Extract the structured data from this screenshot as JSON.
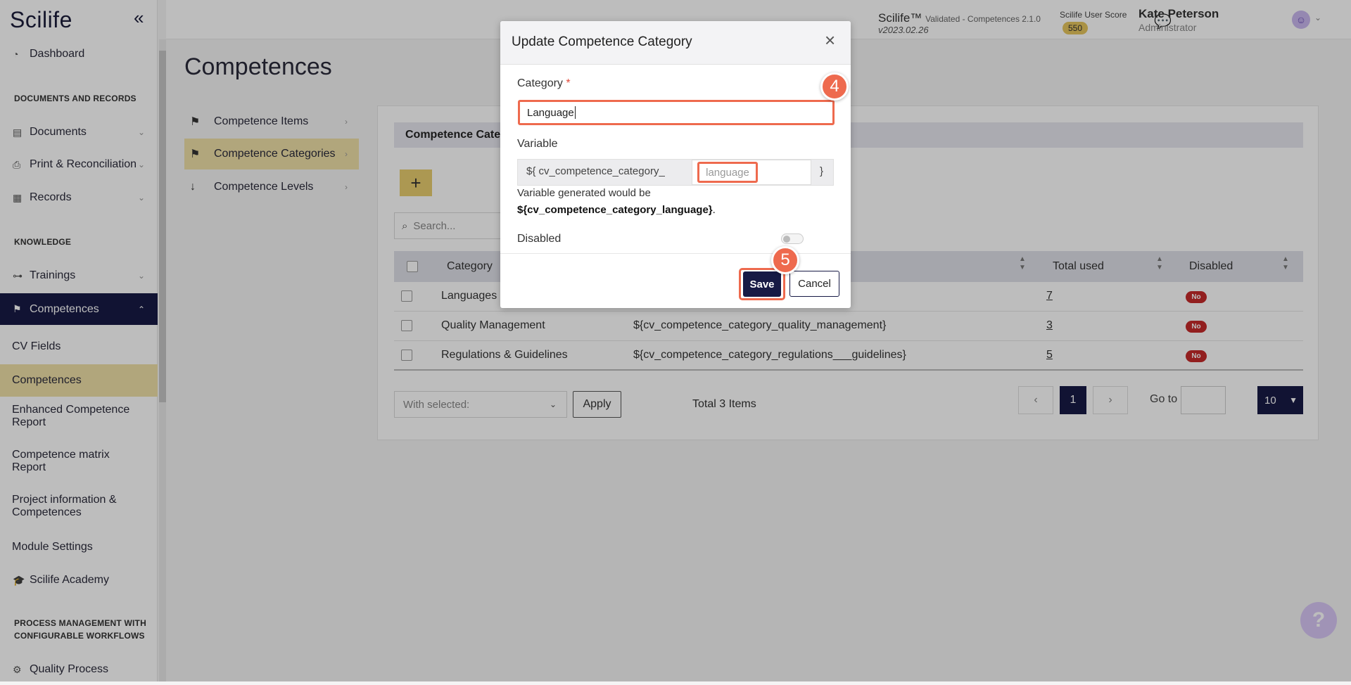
{
  "app": {
    "logo": "Scilife",
    "collapse_icon": "double-chevron-left-icon"
  },
  "topbar": {
    "brand": "Scilife™",
    "brand_sub": "Validated - Competences 2.1.0",
    "version": "v2023.02.26",
    "score_label": "Scilife User Score",
    "score_value": "550",
    "user_name": "Kate Peterson",
    "user_role": "Administrator"
  },
  "sidebar": {
    "dashboard": "Dashboard",
    "section_docs": "DOCUMENTS AND RECORDS",
    "documents": "Documents",
    "print": "Print & Reconciliation",
    "records": "Records",
    "section_knowledge": "KNOWLEDGE",
    "trainings": "Trainings",
    "competences": "Competences",
    "cv_fields": "CV Fields",
    "competences_sub": "Competences",
    "enhanced_report_1": "Enhanced Competence",
    "enhanced_report_2": "Report",
    "matrix_report_1": "Competence matrix",
    "matrix_report_2": "Report",
    "project_info_1": "Project information &",
    "project_info_2": "Competences",
    "module_settings": "Module Settings",
    "academy": "Scilife Academy",
    "section_process_1": "PROCESS MANAGEMENT WITH",
    "section_process_2": "CONFIGURABLE WORKFLOWS",
    "quality_process": "Quality Process"
  },
  "page": {
    "title": "Competences",
    "submenu": {
      "items": "Competence Items",
      "categories": "Competence Categories",
      "levels": "Competence Levels"
    },
    "card_header": "Competence Categories",
    "search_placeholder": "Search...",
    "table": {
      "headers": {
        "category": "Category",
        "total_used": "Total used",
        "disabled": "Disabled"
      },
      "rows": [
        {
          "category": "Languages",
          "variable": "",
          "total_used": "7",
          "disabled": "No"
        },
        {
          "category": "Quality Management",
          "variable": "${cv_competence_category_quality_management}",
          "total_used": "3",
          "disabled": "No"
        },
        {
          "category": "Regulations & Guidelines",
          "variable": "${cv_competence_category_regulations___guidelines}",
          "total_used": "5",
          "disabled": "No"
        }
      ]
    },
    "bulk_placeholder": "With selected:",
    "apply": "Apply",
    "total_items": "Total 3 Items",
    "pagination": {
      "prev": "‹",
      "current": "1",
      "next": "›",
      "goto_label": "Go to",
      "per_page": "10"
    }
  },
  "modal": {
    "title": "Update Competence Category",
    "category_label": "Category",
    "required_mark": "*",
    "category_value": "Language",
    "variable_label": "Variable",
    "variable_prefix": "${ cv_competence_category_",
    "variable_value": "language",
    "variable_suffix": "}",
    "variable_hint": "Variable generated would be",
    "variable_generated": "${cv_competence_category_language}",
    "disabled_label": "Disabled",
    "disabled_on": false,
    "save": "Save",
    "cancel": "Cancel"
  },
  "annotations": {
    "step_4": "4",
    "step_5": "5",
    "accent": "#ee6a4e"
  },
  "colors": {
    "navy": "#171a45",
    "gold": "#e8cd6f",
    "danger": "#c62b2b"
  }
}
